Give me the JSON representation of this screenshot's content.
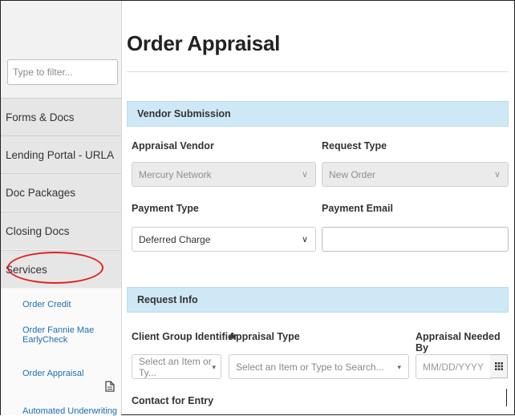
{
  "sidebar": {
    "filter_placeholder": "Type to filter...",
    "items": [
      {
        "label": "Forms & Docs"
      },
      {
        "label": "Lending Portal - URLA"
      },
      {
        "label": "Doc Packages"
      },
      {
        "label": "Closing Docs"
      },
      {
        "label": "Services",
        "highlighted": true
      }
    ],
    "sub_items": [
      {
        "label": "Order Credit"
      },
      {
        "label": "Order Fannie Mae EarlyCheck"
      },
      {
        "label": "Order Appraisal"
      },
      {
        "label": "Automated Underwriting"
      }
    ],
    "highlight_color": "#e02020"
  },
  "main": {
    "title": "Order Appraisal",
    "vendor_section": {
      "header": "Vendor Submission",
      "appraisal_vendor_label": "Appraisal Vendor",
      "appraisal_vendor_value": "Mercury Network",
      "request_type_label": "Request Type",
      "request_type_value": "New Order",
      "payment_type_label": "Payment Type",
      "payment_type_value": "Deferred Charge",
      "payment_email_label": "Payment Email",
      "payment_email_value": ""
    },
    "request_section": {
      "header": "Request Info",
      "client_group_label": "Client Group Identifier",
      "client_group_placeholder": "Select an Item or Ty...",
      "appraisal_type_label": "Appraisal Type",
      "appraisal_type_placeholder": "Select an Item or Type to Search...",
      "needed_by_label": "Appraisal Needed By",
      "needed_by_placeholder": "MM/DD/YYYY",
      "contact_label": "Contact for Entry"
    },
    "section_color": "#cfe8f6"
  }
}
